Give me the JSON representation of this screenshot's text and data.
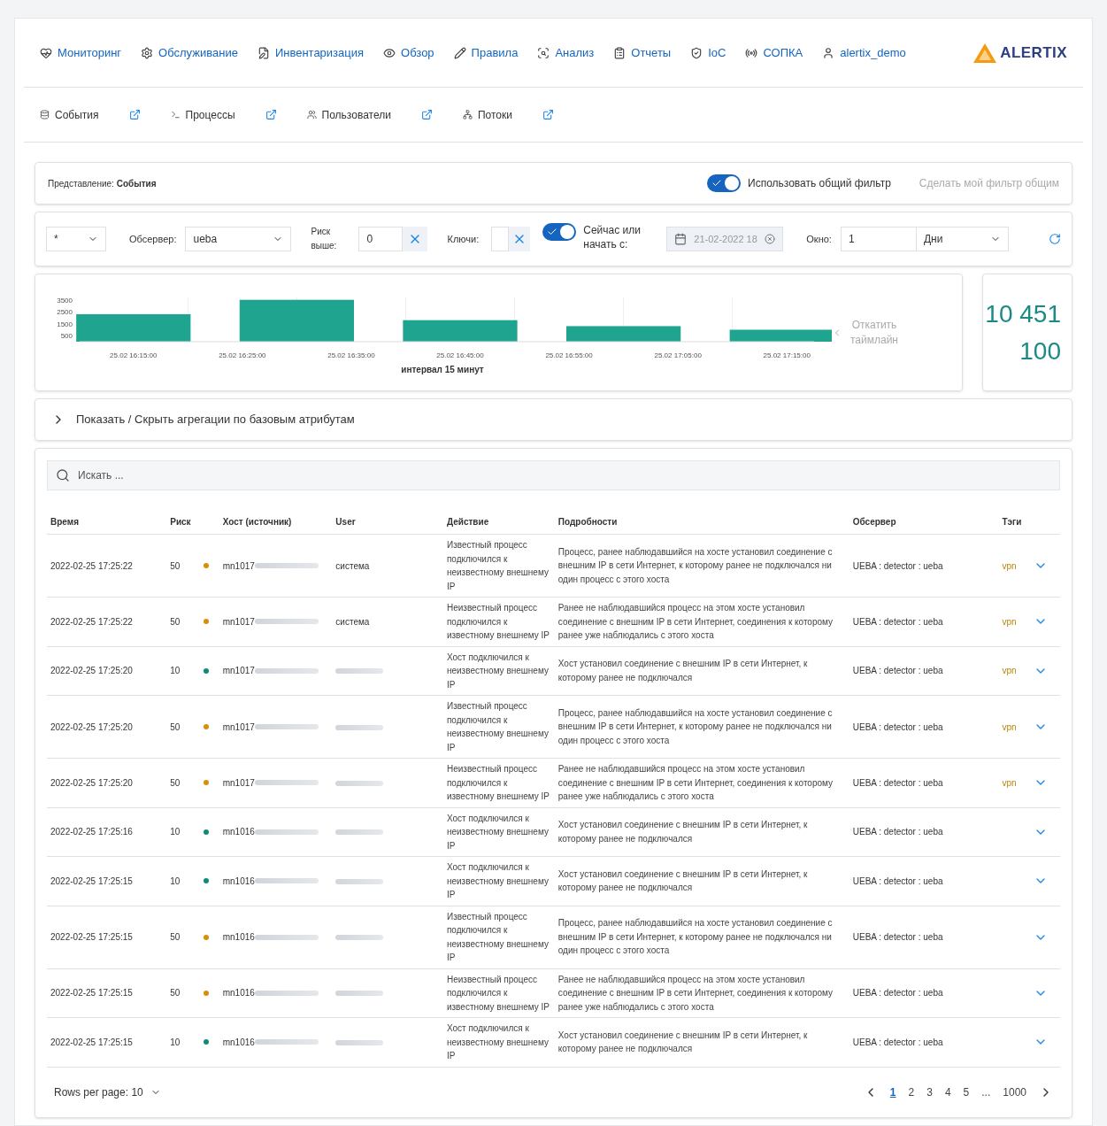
{
  "nav": [
    {
      "label": "Мониторинг"
    },
    {
      "label": "Обслуживание"
    },
    {
      "label": "Инвентаризация"
    },
    {
      "label": "Обзор"
    },
    {
      "label": "Правила"
    },
    {
      "label": "Анализ"
    },
    {
      "label": "Отчеты"
    },
    {
      "label": "IoC"
    },
    {
      "label": "СОПКА"
    },
    {
      "label": "alertix_demo"
    }
  ],
  "logo": {
    "text": "ALERTIX"
  },
  "subnav": [
    {
      "label": "События"
    },
    {
      "label": "Процессы"
    },
    {
      "label": "Пользователи"
    },
    {
      "label": "Потоки"
    }
  ],
  "view": {
    "label": "Представление:",
    "value": "События",
    "shared_filter": {
      "label": "Использовать общий фильтр",
      "on": true
    },
    "make_shared": {
      "label": "Сделать мой фильтр общим",
      "disabled": true
    }
  },
  "filters": {
    "scope": {
      "value": "*"
    },
    "observer": {
      "label": "Обсервер:",
      "value": "ueba"
    },
    "risk": {
      "label": "Риск выше:",
      "value": "0"
    },
    "keys": {
      "label": "Ключи:"
    },
    "now": {
      "label": "Сейчас или начать с:",
      "on": true
    },
    "date": {
      "value": "21-02-2022 18",
      "disabled": true
    },
    "window": {
      "label": "Окно:",
      "value": "1",
      "unit": "Дни"
    }
  },
  "chart_data": {
    "type": "bar",
    "categories": [
      "25.02 16:15:00",
      null,
      "25.02 16:25:00",
      null,
      "25.02 16:35:00",
      null,
      "25.02 16:45:00",
      null,
      "25.02 16:55:00",
      null,
      "25.02 17:05:00",
      null,
      "25.02 17:15:00"
    ],
    "series": [
      {
        "color": "#1fa58f",
        "values": [
          2300,
          null,
          null,
          3500,
          null,
          null,
          1800,
          null,
          null,
          1300,
          null,
          null,
          1000
        ]
      }
    ],
    "yticks": [
      500,
      1500,
      2500,
      3500
    ],
    "ylim": [
      0,
      3700
    ],
    "grid": true,
    "xlabel": "интервал 15 минут"
  },
  "rollback": {
    "label": "Откатить таймлайн"
  },
  "counts": {
    "total": "10 451",
    "shown": "100"
  },
  "aggregations": {
    "label": "Показать / Скрыть агрегации по базовым атрибутам",
    "expanded": false
  },
  "search": {
    "placeholder": "Искать ..."
  },
  "table": {
    "columns": [
      "Время",
      "Риск",
      "Хост (источник)",
      "User",
      "Действие",
      "Подробности",
      "Обсервер",
      "Тэги"
    ],
    "rows": [
      {
        "time": "2022-02-25 17:25:22",
        "risk": "50",
        "color": "#d4900a",
        "host": "mn1017",
        "user": "система",
        "action": "Известный процесс подключился к неизвестному внешнему IP",
        "details": "Процесс, ранее наблюдавшийся на хосте установил соединение с внешним IP в сети Интернет, к которому ранее не подключался ни один процесс с этого хоста",
        "observer": "UEBA : detector : ueba",
        "tag": "vpn"
      },
      {
        "time": "2022-02-25 17:25:22",
        "risk": "50",
        "color": "#d4900a",
        "host": "mn1017",
        "user": "система",
        "action": "Неизвестный процесс подключился к известному внешнему IP",
        "details": "Ранее не наблюдавшийся процесс на этом хосте установил соединение с внешним IP в сети Интернет, соединения к которому ранее уже наблюдались с этого хоста",
        "observer": "UEBA : detector : ueba",
        "tag": "vpn"
      },
      {
        "time": "2022-02-25 17:25:20",
        "risk": "10",
        "color": "#0f8a7a",
        "host": "mn1017",
        "action": "Хост подключился к неизвестному внешнему IP",
        "details": "Хост установил соединение с внешним IP в сети Интернет, к которому ранее не подключался",
        "observer": "UEBA : detector : ueba",
        "tag": "vpn"
      },
      {
        "time": "2022-02-25 17:25:20",
        "risk": "50",
        "color": "#d4900a",
        "host": "mn1017",
        "action": "Известный процесс подключился к неизвестному внешнему IP",
        "details": "Процесс, ранее наблюдавшийся на хосте установил соединение с внешним IP в сети Интернет, к которому ранее не подключался ни один процесс с этого хоста",
        "observer": "UEBA : detector : ueba",
        "tag": "vpn"
      },
      {
        "time": "2022-02-25 17:25:20",
        "risk": "50",
        "color": "#d4900a",
        "host": "mn1017",
        "action": "Неизвестный процесс подключился к известному внешнему IP",
        "details": "Ранее не наблюдавшийся процесс на этом хосте установил соединение с внешним IP в сети Интернет, соединения к которому ранее уже наблюдались с этого хоста",
        "observer": "UEBA : detector : ueba",
        "tag": "vpn"
      },
      {
        "time": "2022-02-25 17:25:16",
        "risk": "10",
        "color": "#0f8a7a",
        "host": "mn1016",
        "action": "Хост подключился к неизвестному внешнему IP",
        "details": "Хост установил соединение с внешним IP в сети Интернет, к которому ранее не подключался",
        "observer": "UEBA : detector : ueba"
      },
      {
        "time": "2022-02-25 17:25:15",
        "risk": "10",
        "color": "#0f8a7a",
        "host": "mn1016",
        "action": "Хост подключился к неизвестному внешнему IP",
        "details": "Хост установил соединение с внешним IP в сети Интернет, к которому ранее не подключался",
        "observer": "UEBA : detector : ueba"
      },
      {
        "time": "2022-02-25 17:25:15",
        "risk": "50",
        "color": "#d4900a",
        "host": "mn1016",
        "action": "Известный процесс подключился к неизвестному внешнему IP",
        "details": "Процесс, ранее наблюдавшийся на хосте установил соединение с внешним IP в сети Интернет, к которому ранее не подключался ни один процесс с этого хоста",
        "observer": "UEBA : detector : ueba"
      },
      {
        "time": "2022-02-25 17:25:15",
        "risk": "50",
        "color": "#d4900a",
        "host": "mn1016",
        "action": "Неизвестный процесс подключился к известному внешнему IP",
        "details": "Ранее не наблюдавшийся процесс на этом хосте установил соединение с внешним IP в сети Интернет, соединения к которому ранее уже наблюдались с этого хоста",
        "observer": "UEBA : detector : ueba"
      },
      {
        "time": "2022-02-25 17:25:15",
        "risk": "10",
        "color": "#0f8a7a",
        "host": "mn1016",
        "action": "Хост подключился к неизвестному внешнему IP",
        "details": "Хост установил соединение с внешним IP в сети Интернет, к которому ранее не подключался",
        "observer": "UEBA : detector : ueba"
      }
    ]
  },
  "pagination": {
    "rows_per_page": "Rows per page: 10",
    "pages": [
      {
        "label": "1",
        "selected": true
      },
      {
        "label": "2",
        "selected": false
      },
      {
        "label": "3",
        "selected": false
      },
      {
        "label": "4",
        "selected": false
      },
      {
        "label": "5",
        "selected": false
      },
      {
        "label": "...",
        "selected": false
      },
      {
        "label": "1000",
        "selected": false
      }
    ]
  }
}
